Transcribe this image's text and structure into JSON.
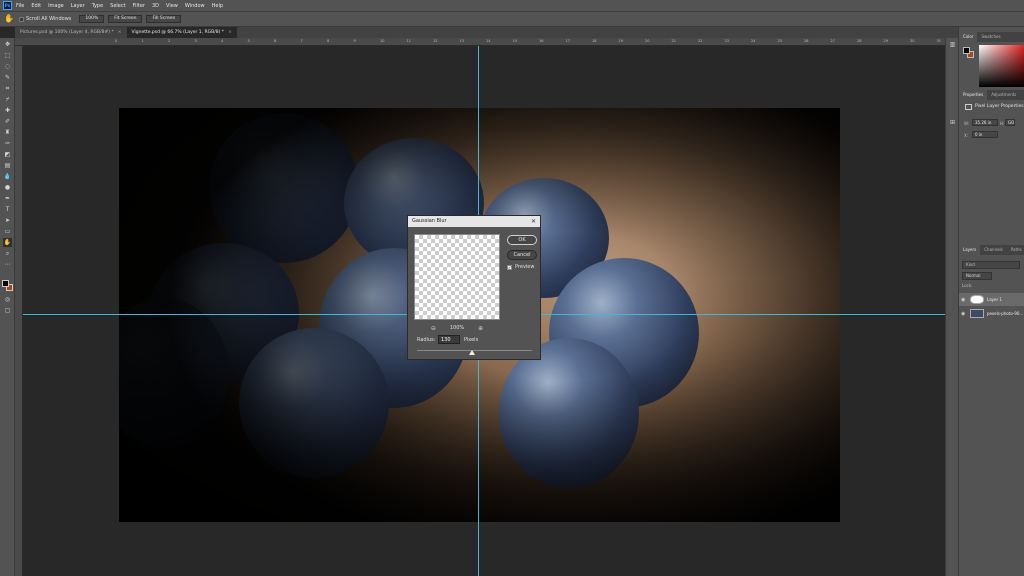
{
  "menubar": {
    "logo": "Ps",
    "items": [
      "File",
      "Edit",
      "Image",
      "Layer",
      "Type",
      "Select",
      "Filter",
      "3D",
      "View",
      "Window",
      "Help"
    ]
  },
  "options_bar": {
    "scroll_all_label": "Scroll All Windows",
    "zoom_button": "100%",
    "fit_screen_button": "Fit Screen",
    "fill_screen_button": "Fill Screen"
  },
  "doc_tabs": [
    {
      "label": "Pictures.psd @ 100% (Layer 4, RGB/8#) *",
      "active": false
    },
    {
      "label": "Vignette.psd @ 66.7% (Layer 1, RGB/8) *",
      "active": true
    }
  ],
  "rulers": {
    "top_labels": [
      "0",
      "1",
      "2",
      "3",
      "4",
      "5",
      "6",
      "7",
      "8",
      "9",
      "10",
      "11",
      "12",
      "13",
      "14",
      "15",
      "16",
      "17",
      "18",
      "19",
      "20",
      "21",
      "22",
      "23",
      "24",
      "25",
      "26",
      "27",
      "28",
      "29",
      "30",
      "31",
      "32"
    ]
  },
  "dialog": {
    "title": "Gaussian Blur",
    "ok_label": "OK",
    "cancel_label": "Cancel",
    "preview_label": "Preview",
    "preview_checked": true,
    "zoom_value": "100%",
    "radius_label": "Radius:",
    "radius_value": "130",
    "radius_unit": "Pixels"
  },
  "panels": {
    "color_tabs": [
      "Color",
      "Swatches"
    ],
    "properties_tabs": [
      "Properties",
      "Adjustments"
    ],
    "properties_title": "Pixel Layer Properties",
    "prop_w_label": "W:",
    "prop_w_value": "35.26 in",
    "prop_h_label": "H:",
    "prop_h_value": "GO",
    "prop_x_label": "X:",
    "prop_x_value": "0 in",
    "layers_tabs": [
      "Layers",
      "Channels",
      "Paths"
    ],
    "layers_search": "Kind",
    "blend_mode": "Normal",
    "lock_label": "Lock:",
    "layers": [
      {
        "name": "Layer 1",
        "selected": true
      },
      {
        "name": "pexels-photo-90...",
        "selected": false
      }
    ]
  },
  "colors": {
    "foreground": "#000000",
    "background": "#a04a1c",
    "guide": "#3fb8d8"
  }
}
